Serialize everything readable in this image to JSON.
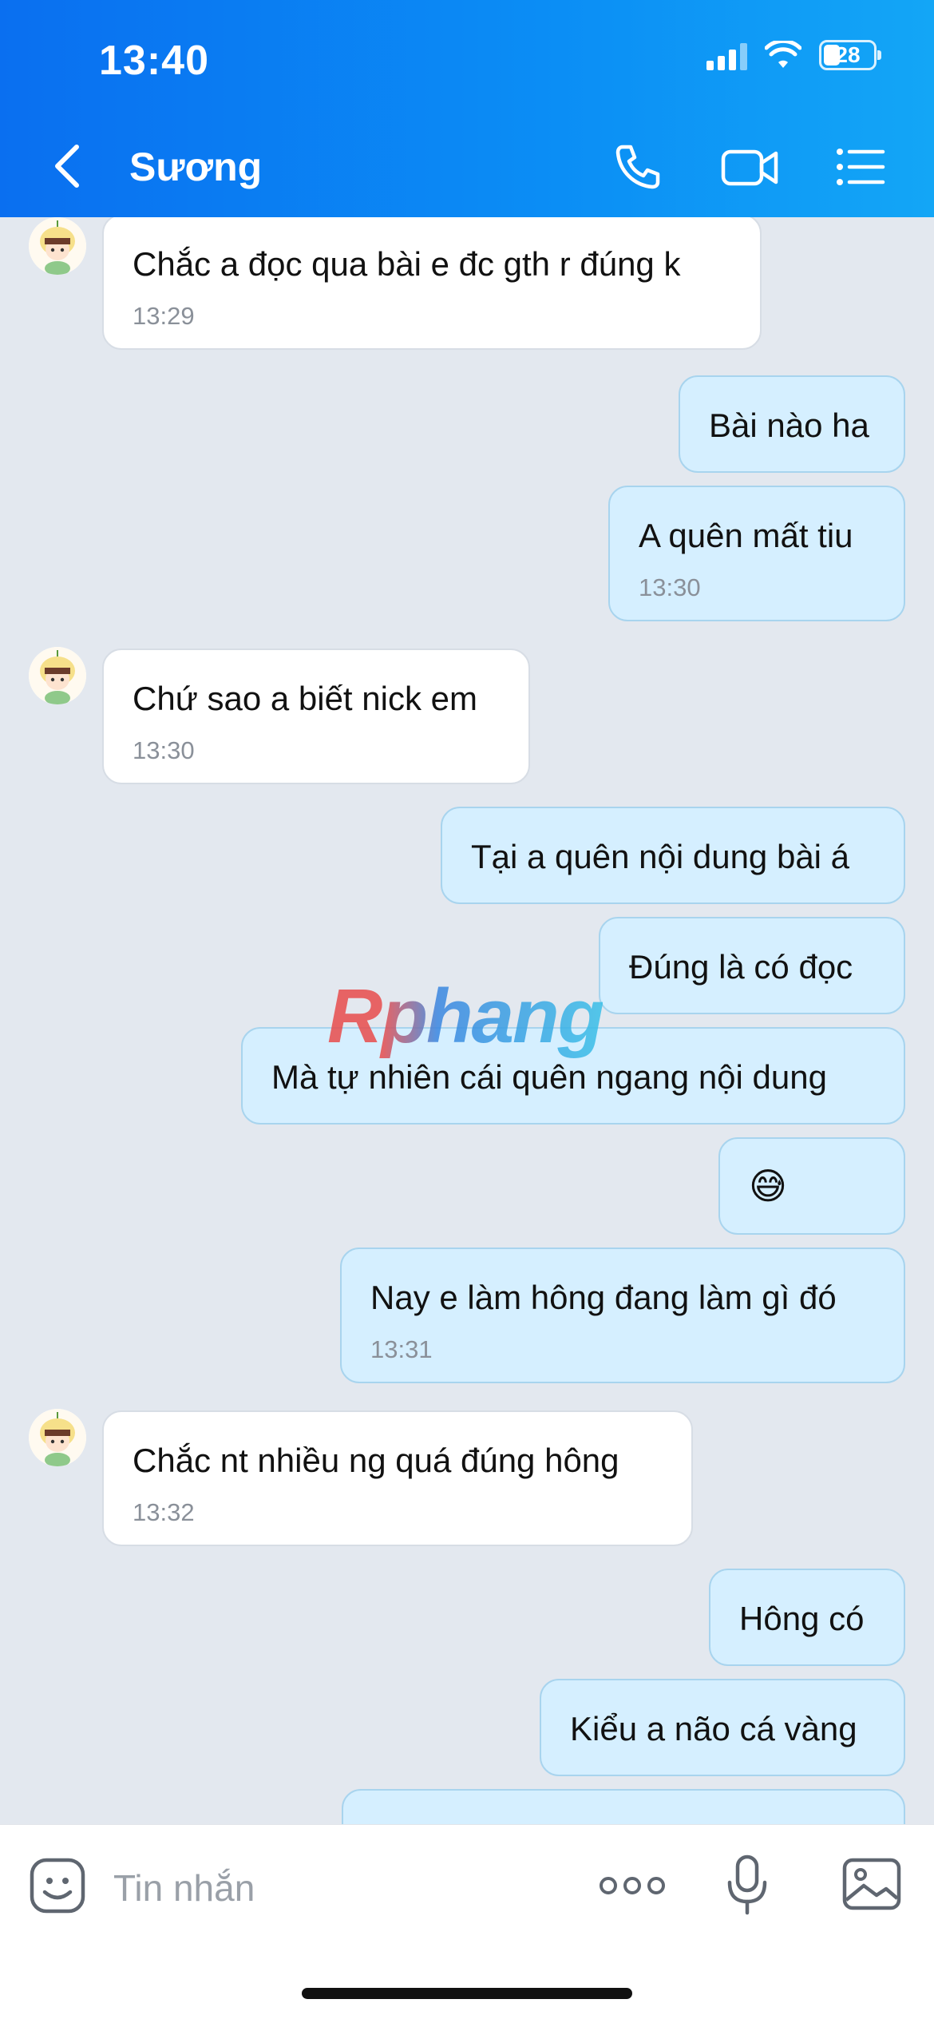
{
  "status": {
    "time": "13:40",
    "battery": "28"
  },
  "header": {
    "contact_name": "Sương"
  },
  "messages": [
    {
      "dir": "in",
      "text": "Chắc a đọc qua bài e đc gth r đúng k",
      "time": "13:29"
    },
    {
      "dir": "out",
      "text": "Bài nào ha",
      "time": ""
    },
    {
      "dir": "out",
      "text": "A quên mất tiu",
      "time": "13:30"
    },
    {
      "dir": "in",
      "text": "Chứ sao a biết nick em",
      "time": "13:30"
    },
    {
      "dir": "out",
      "text": "Tại a quên nội dung bài á",
      "time": ""
    },
    {
      "dir": "out",
      "text": "Đúng là có đọc",
      "time": ""
    },
    {
      "dir": "out",
      "text": "Mà tự nhiên cái quên ngang nội dung",
      "time": ""
    },
    {
      "dir": "out",
      "text": "😅",
      "time": ""
    },
    {
      "dir": "out",
      "text": "Nay e làm hông đang làm gì đó",
      "time": "13:31"
    },
    {
      "dir": "in",
      "text": "Chắc nt nhiều ng quá đúng hông",
      "time": "13:32"
    },
    {
      "dir": "out",
      "text": "Hông có",
      "time": ""
    },
    {
      "dir": "out",
      "text": "Kiểu a não cá vàng",
      "time": ""
    }
  ],
  "watermark": "Rphang",
  "composer": {
    "placeholder": "Tin nhắn"
  },
  "colors": {
    "header_start": "#0a6ff0",
    "header_end": "#13a6f6",
    "outgoing_bubble": "#d5efff",
    "incoming_bubble": "#ffffff",
    "chat_bg": "#e3e8ef"
  }
}
